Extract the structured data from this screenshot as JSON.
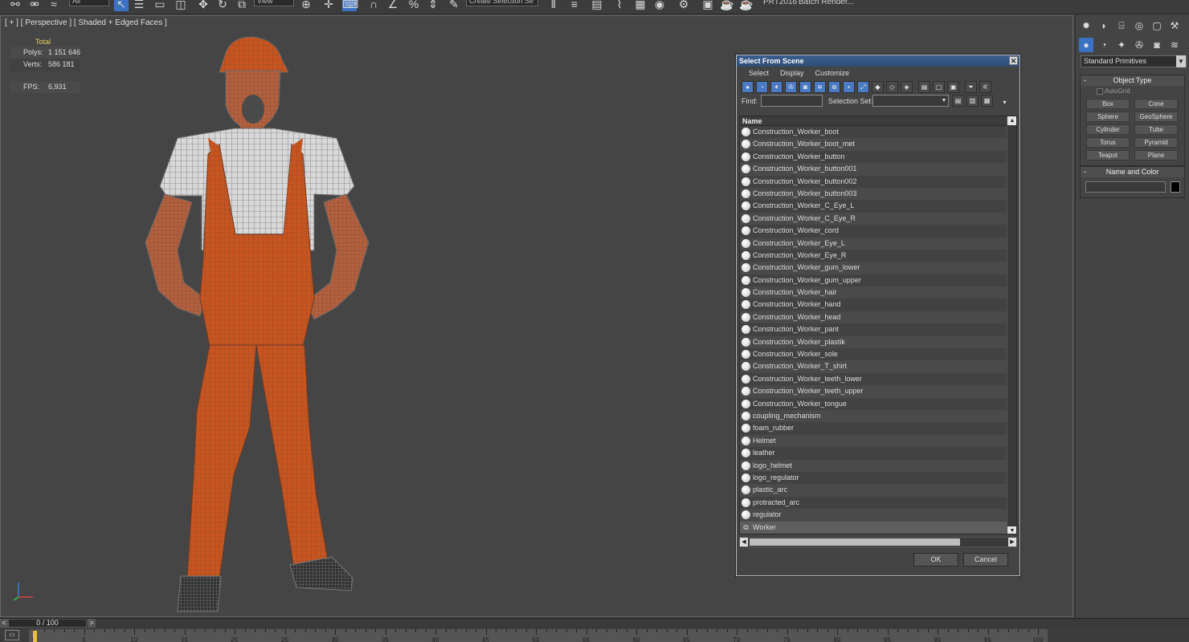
{
  "toolbar": {
    "filter_dropdown": "All",
    "ref_coord_dropdown": "View",
    "named_selection": "Create Selection Se",
    "prt_label": "PRT2016",
    "batch_render": "Batch Render..."
  },
  "viewport": {
    "label": "[ + ] [ Perspective ] [ Shaded + Edged Faces ]",
    "stats": {
      "total_label": "Total",
      "polys_label": "Polys:",
      "polys_value": "1 151 646",
      "verts_label": "Verts:",
      "verts_value": "586 181",
      "fps_label": "FPS:",
      "fps_value": "6,931"
    }
  },
  "dialog": {
    "title": "Select From Scene",
    "menu": [
      "Select",
      "Display",
      "Customize"
    ],
    "find_label": "Find:",
    "find_value": "",
    "selection_set_label": "Selection Set:",
    "selection_set_value": "",
    "column_header": "Name",
    "items": [
      {
        "name": "Construction_Worker_boot",
        "icon": "sphere-icon"
      },
      {
        "name": "Construction_Worker_boot_met",
        "icon": "sphere-icon"
      },
      {
        "name": "Construction_Worker_button",
        "icon": "sphere-icon"
      },
      {
        "name": "Construction_Worker_button001",
        "icon": "sphere-icon"
      },
      {
        "name": "Construction_Worker_button002",
        "icon": "sphere-icon"
      },
      {
        "name": "Construction_Worker_button003",
        "icon": "sphere-icon"
      },
      {
        "name": "Construction_Worker_C_Eye_L",
        "icon": "sphere-icon"
      },
      {
        "name": "Construction_Worker_C_Eye_R",
        "icon": "sphere-icon"
      },
      {
        "name": "Construction_Worker_cord",
        "icon": "sphere-icon"
      },
      {
        "name": "Construction_Worker_Eye_L",
        "icon": "sphere-icon"
      },
      {
        "name": "Construction_Worker_Eye_R",
        "icon": "sphere-icon"
      },
      {
        "name": "Construction_Worker_gum_lower",
        "icon": "sphere-icon"
      },
      {
        "name": "Construction_Worker_gum_upper",
        "icon": "sphere-icon"
      },
      {
        "name": "Construction_Worker_hair",
        "icon": "sphere-icon"
      },
      {
        "name": "Construction_Worker_hand",
        "icon": "sphere-icon"
      },
      {
        "name": "Construction_Worker_head",
        "icon": "sphere-icon"
      },
      {
        "name": "Construction_Worker_pant",
        "icon": "sphere-icon"
      },
      {
        "name": "Construction_Worker_plastik",
        "icon": "sphere-icon"
      },
      {
        "name": "Construction_Worker_sole",
        "icon": "sphere-icon"
      },
      {
        "name": "Construction_Worker_T_shirt",
        "icon": "sphere-icon"
      },
      {
        "name": "Construction_Worker_teeth_lower",
        "icon": "sphere-icon"
      },
      {
        "name": "Construction_Worker_teeth_upper",
        "icon": "sphere-icon"
      },
      {
        "name": "Construction_Worker_tongue",
        "icon": "sphere-icon"
      },
      {
        "name": "coupling_mechanism",
        "icon": "sphere-icon"
      },
      {
        "name": "foam_rubber",
        "icon": "sphere-icon"
      },
      {
        "name": "Helmet",
        "icon": "sphere-icon"
      },
      {
        "name": "leather",
        "icon": "sphere-icon"
      },
      {
        "name": "logo_helmet",
        "icon": "sphere-icon"
      },
      {
        "name": "logo_regulator",
        "icon": "sphere-icon"
      },
      {
        "name": "plastic_arc",
        "icon": "sphere-icon"
      },
      {
        "name": "protracted_arc",
        "icon": "sphere-icon"
      },
      {
        "name": "regulator",
        "icon": "sphere-icon"
      },
      {
        "name": "Worker",
        "icon": "group-icon"
      }
    ],
    "ok_label": "OK",
    "cancel_label": "Cancel"
  },
  "command_panel": {
    "primitives_dropdown": "Standard Primitives",
    "object_type_title": "Object Type",
    "autogrid_label": "AutoGrid",
    "object_buttons": [
      "Box",
      "Cone",
      "Sphere",
      "GeoSphere",
      "Cylinder",
      "Tube",
      "Torus",
      "Pyramid",
      "Teapot",
      "Plane"
    ],
    "name_color_title": "Name and Color",
    "name_value": ""
  },
  "time_slider": {
    "label": "0 / 100",
    "prev": "<",
    "next": ">"
  },
  "trackbar": {
    "tick_labels": [
      "0",
      "5",
      "10",
      "15",
      "20",
      "25",
      "30",
      "35",
      "40",
      "45",
      "50",
      "55",
      "60",
      "65",
      "70",
      "75",
      "80",
      "85",
      "90",
      "95",
      "100"
    ]
  },
  "colors": {
    "accent": "#3b72c4",
    "stats_text": "#e0d060",
    "overalls": "#c8541f",
    "frame_marker": "#e7c23a"
  }
}
